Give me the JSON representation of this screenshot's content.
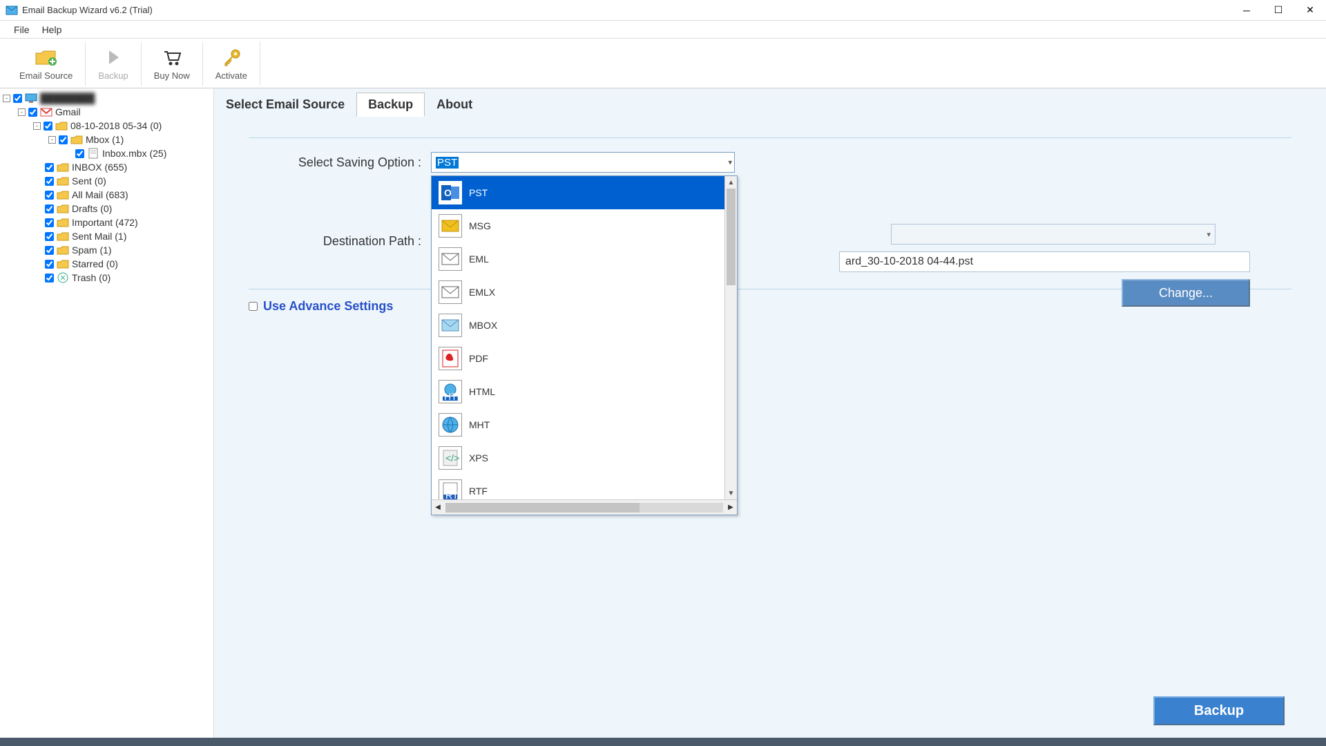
{
  "window": {
    "title": "Email Backup Wizard v6.2 (Trial)"
  },
  "menu": {
    "file": "File",
    "help": "Help"
  },
  "toolbar": {
    "email_source": "Email Source",
    "backup": "Backup",
    "buy_now": "Buy Now",
    "activate": "Activate"
  },
  "tabs": {
    "select_source": "Select Email Source",
    "backup": "Backup",
    "about": "About"
  },
  "form": {
    "saving_option_label": "Select Saving Option :",
    "saving_option_value": "PST",
    "destination_label": "Destination Path :",
    "destination_value": "ard_30-10-2018 04-44.pst",
    "change_btn": "Change...",
    "advance_label": "Use Advance Settings",
    "backup_btn": "Backup"
  },
  "dropdown": {
    "options": [
      {
        "label": "PST",
        "selected": true,
        "icon": "pst"
      },
      {
        "label": "MSG",
        "icon": "msg"
      },
      {
        "label": "EML",
        "icon": "eml"
      },
      {
        "label": "EMLX",
        "icon": "emlx"
      },
      {
        "label": "MBOX",
        "icon": "mbox"
      },
      {
        "label": "PDF",
        "icon": "pdf"
      },
      {
        "label": "HTML",
        "icon": "html"
      },
      {
        "label": "MHT",
        "icon": "mht"
      },
      {
        "label": "XPS",
        "icon": "xps"
      },
      {
        "label": "RTF",
        "icon": "rtf"
      }
    ]
  },
  "tree": [
    {
      "indent": 0,
      "exp": "-",
      "checked": true,
      "icon": "monitor",
      "label": "",
      "blur": true
    },
    {
      "indent": 1,
      "exp": "-",
      "checked": true,
      "icon": "gmail",
      "label": "Gmail"
    },
    {
      "indent": 2,
      "exp": "-",
      "checked": true,
      "icon": "folder",
      "label": "08-10-2018 05-34 (0)"
    },
    {
      "indent": 3,
      "exp": "-",
      "checked": true,
      "icon": "folder",
      "label": "Mbox (1)"
    },
    {
      "indent": 4,
      "exp": "",
      "checked": true,
      "icon": "doc",
      "label": "Inbox.mbx (25)"
    },
    {
      "indent": 2,
      "exp": "",
      "checked": true,
      "icon": "folder",
      "label": "INBOX (655)"
    },
    {
      "indent": 2,
      "exp": "",
      "checked": true,
      "icon": "folder",
      "label": "Sent (0)"
    },
    {
      "indent": 2,
      "exp": "",
      "checked": true,
      "icon": "folder",
      "label": "All Mail (683)"
    },
    {
      "indent": 2,
      "exp": "",
      "checked": true,
      "icon": "folder",
      "label": "Drafts (0)"
    },
    {
      "indent": 2,
      "exp": "",
      "checked": true,
      "icon": "folder",
      "label": "Important (472)"
    },
    {
      "indent": 2,
      "exp": "",
      "checked": true,
      "icon": "folder",
      "label": "Sent Mail (1)"
    },
    {
      "indent": 2,
      "exp": "",
      "checked": true,
      "icon": "folder",
      "label": "Spam (1)"
    },
    {
      "indent": 2,
      "exp": "",
      "checked": true,
      "icon": "folder",
      "label": "Starred (0)"
    },
    {
      "indent": 2,
      "exp": "",
      "checked": true,
      "icon": "trash",
      "label": "Trash (0)"
    }
  ]
}
